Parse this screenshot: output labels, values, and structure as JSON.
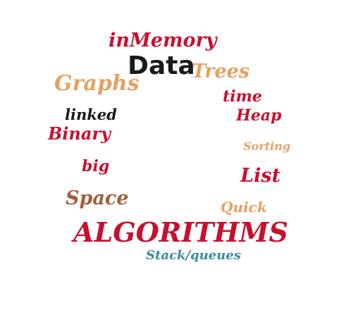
{
  "cloud": {
    "words": {
      "inmemory": {
        "text": "inMemory",
        "color": "#c8102e"
      },
      "data": {
        "text": "Data",
        "color": "#1a1a1a"
      },
      "trees": {
        "text": "Trees",
        "color": "#e8a060"
      },
      "graphs": {
        "text": "Graphs",
        "color": "#e8a060"
      },
      "time": {
        "text": "time",
        "color": "#c8102e"
      },
      "heap": {
        "text": "Heap",
        "color": "#c8102e"
      },
      "linked": {
        "text": "linked",
        "color": "#1a1a1a"
      },
      "binary": {
        "text": "Binary",
        "color": "#c8102e"
      },
      "sorting": {
        "text": "Sorting",
        "color": "#e8a060"
      },
      "big": {
        "text": "big",
        "color": "#c8102e"
      },
      "list": {
        "text": "List",
        "color": "#c8102e"
      },
      "space": {
        "text": "Space",
        "color": "#a0603a"
      },
      "quick": {
        "text": "Quick",
        "color": "#e8a060"
      },
      "algorithms": {
        "text": "ALGORITHMS",
        "color": "#c8102e"
      },
      "stack": {
        "text": "Stack/queues",
        "color": "#3a8a9a"
      }
    }
  }
}
